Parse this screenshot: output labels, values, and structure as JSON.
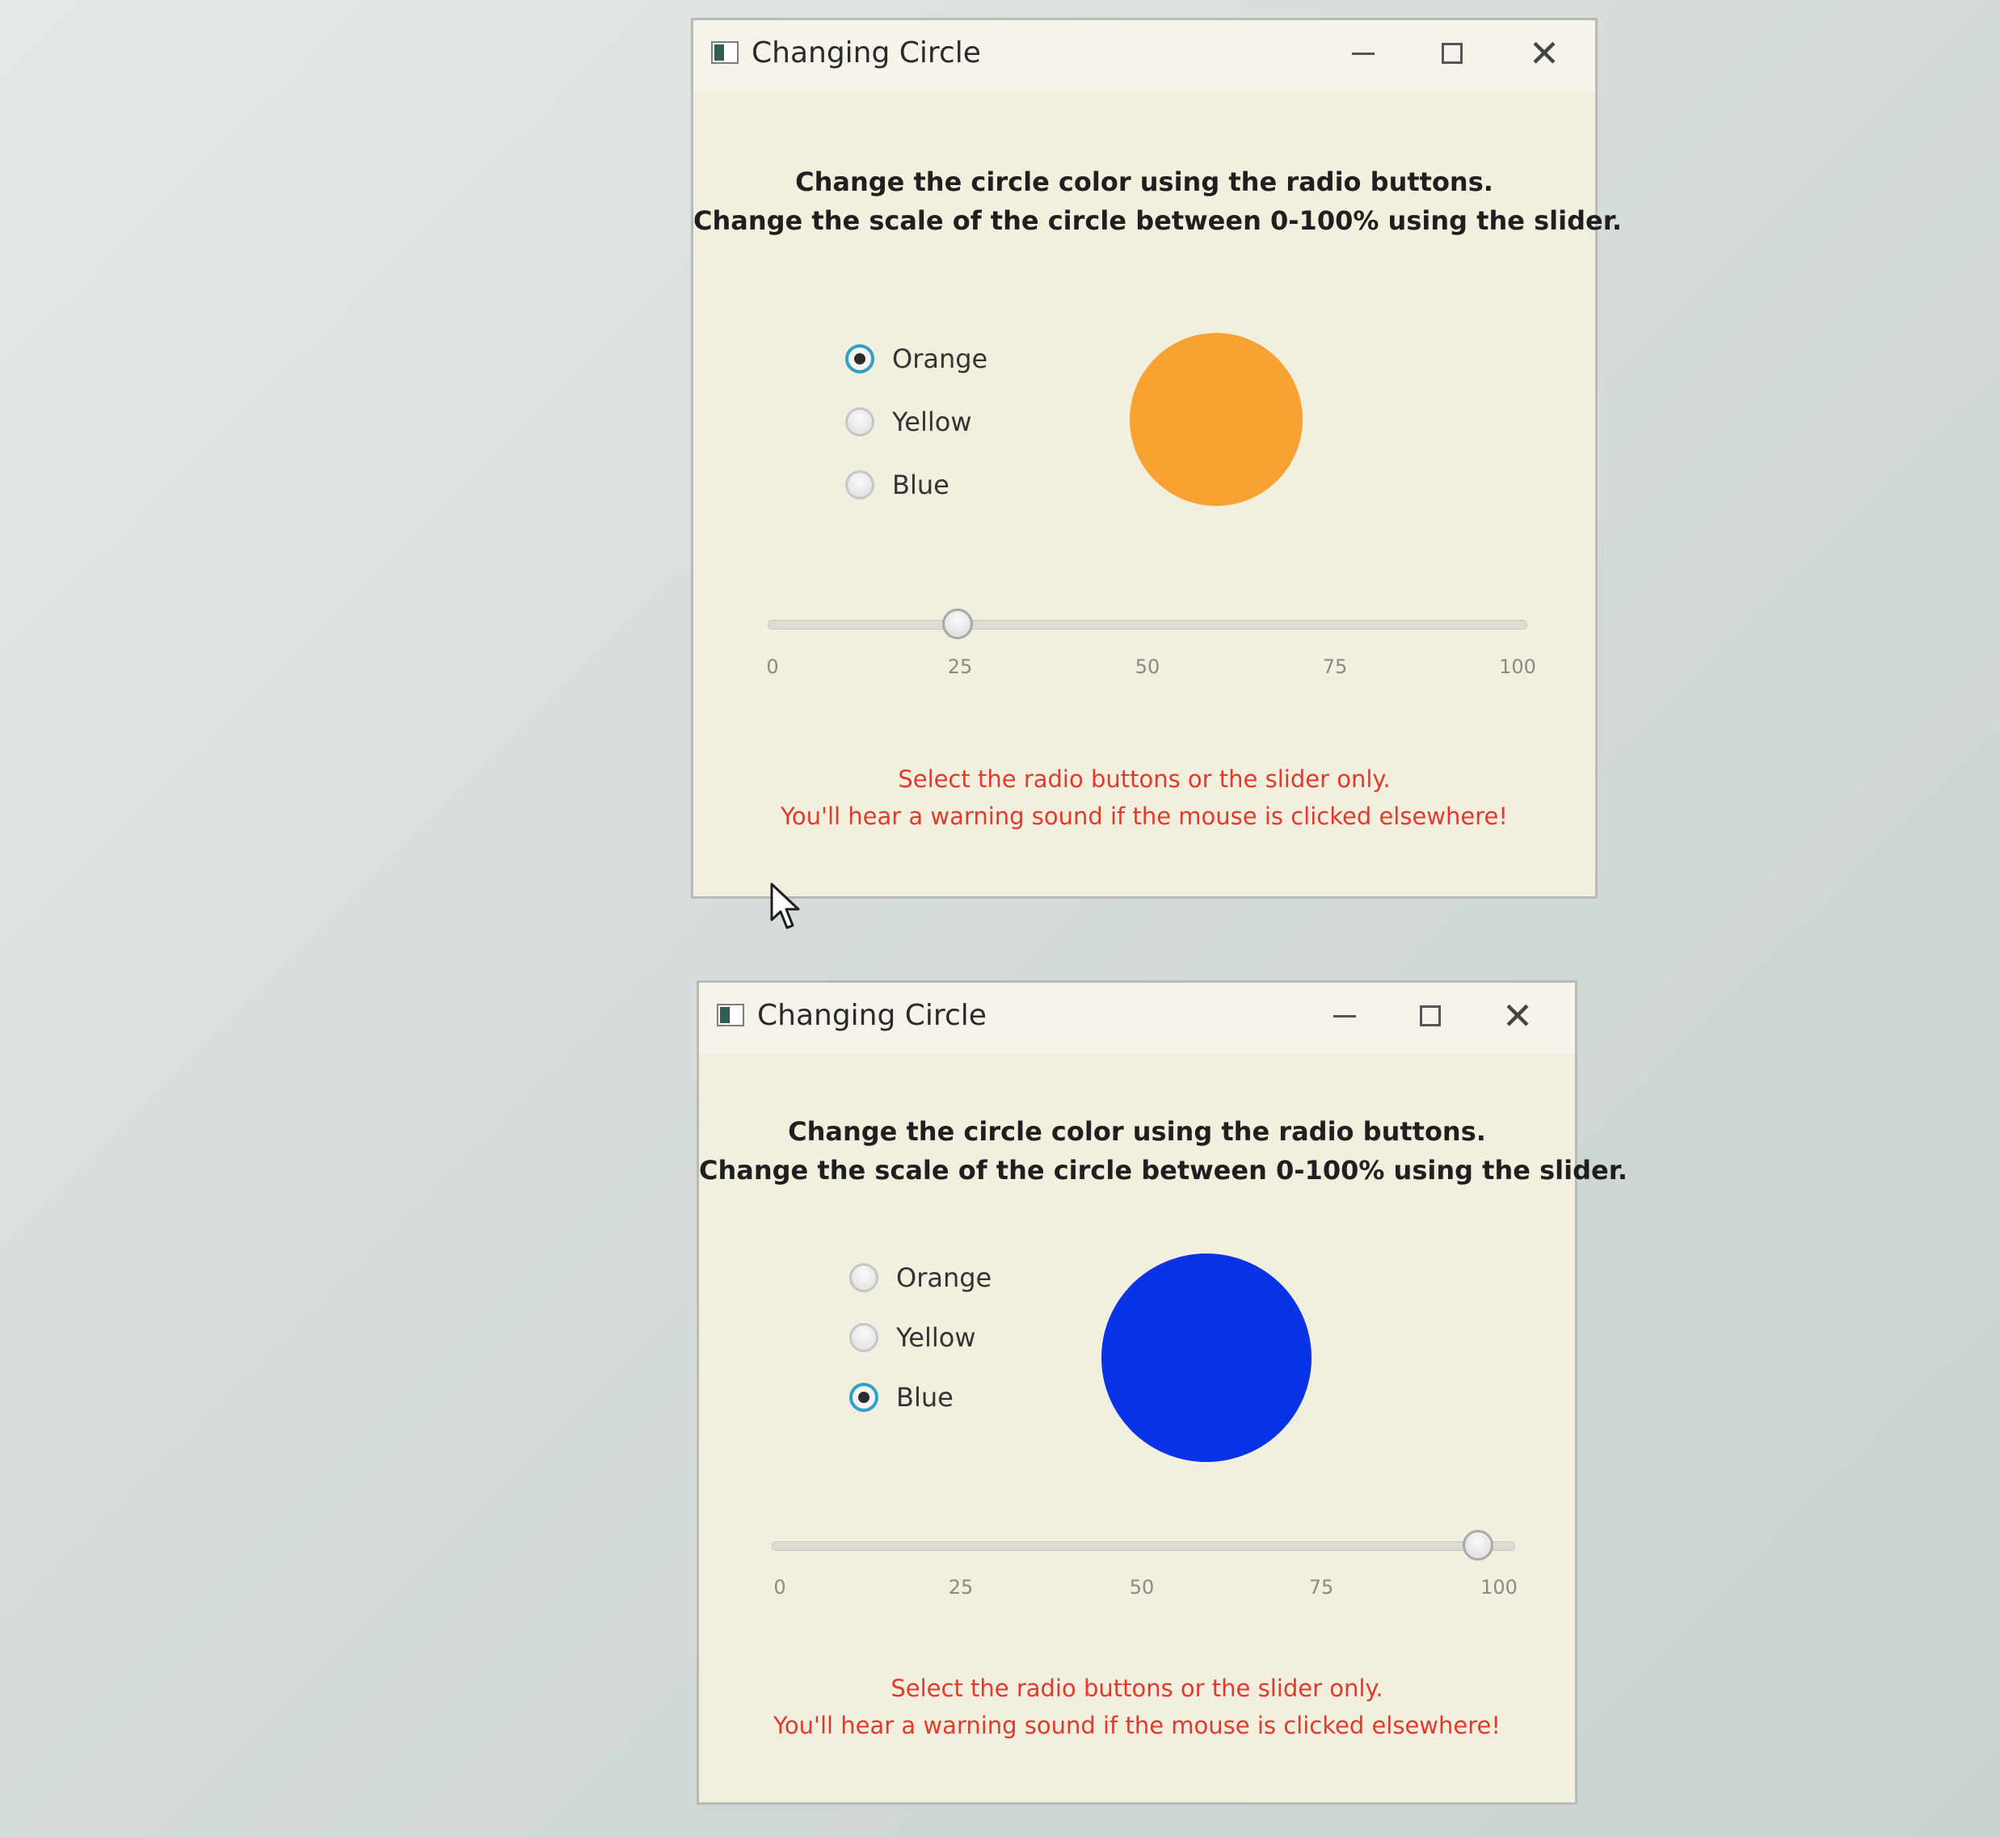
{
  "windows": [
    {
      "title": "Changing Circle",
      "instructions": {
        "line1": "Change the circle color using the radio buttons.",
        "line2": "Change the scale of the circle between 0-100% using the slider."
      },
      "radios": [
        {
          "label": "Orange",
          "checked": true
        },
        {
          "label": "Yellow",
          "checked": false
        },
        {
          "label": "Blue",
          "checked": false
        }
      ],
      "selected_color": "Orange",
      "circle_color": "#f7a233",
      "slider": {
        "value": 25,
        "min": 0,
        "max": 100,
        "ticks": [
          "0",
          "25",
          "50",
          "75",
          "100"
        ]
      },
      "warning": {
        "line1": "Select the radio buttons or the slider only.",
        "line2": "You'll hear a warning sound if the mouse is clicked elsewhere!"
      }
    },
    {
      "title": "Changing Circle",
      "instructions": {
        "line1": "Change the circle color using the radio buttons.",
        "line2": "Change the scale of the circle between 0-100% using the slider."
      },
      "radios": [
        {
          "label": "Orange",
          "checked": false
        },
        {
          "label": "Yellow",
          "checked": false
        },
        {
          "label": "Blue",
          "checked": true
        }
      ],
      "selected_color": "Blue",
      "circle_color": "#0a33e6",
      "slider": {
        "value": 95,
        "min": 0,
        "max": 100,
        "ticks": [
          "0",
          "25",
          "50",
          "75",
          "100"
        ]
      },
      "warning": {
        "line1": "Select the radio buttons or the slider only.",
        "line2": "You'll hear a warning sound if the mouse is clicked elsewhere!"
      }
    }
  ],
  "icons": {
    "app": "window-app-icon",
    "minimize": "minimize-icon",
    "maximize": "maximize-icon",
    "close": "close-icon",
    "cursor": "mouse-cursor-icon"
  }
}
